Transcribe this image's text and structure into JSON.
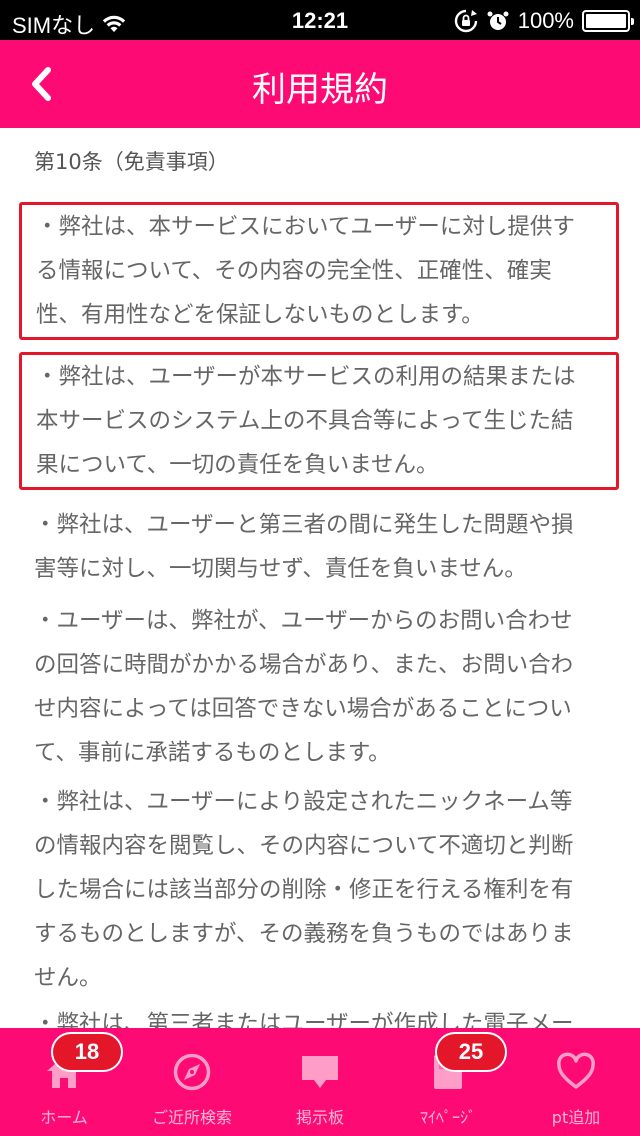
{
  "status_bar": {
    "carrier": "SIMなし",
    "time": "12:21",
    "battery": "100%",
    "battery_level": 1.0
  },
  "header": {
    "title": "利用規約",
    "back_icon": "chevron-left-icon"
  },
  "content": {
    "section_title": "第10条（免責事項）",
    "paragraphs": [
      {
        "lines": [
          "・弊社は、本サービスにおいてユーザーに対し提供す",
          "る情報について、その内容の完全性、正確性、確実",
          "性、有用性などを保証しないものとします。"
        ],
        "highlighted": true
      },
      {
        "lines": [
          "・弊社は、ユーザーが本サービスの利用の結果または",
          "本サービスのシステム上の不具合等によって生じた結",
          "果について、一切の責任を負いません。"
        ],
        "highlighted": true
      },
      {
        "lines": [
          "・弊社は、ユーザーと第三者の間に発生した問題や損",
          "害等に対し、一切関与せず、責任を負いません。"
        ],
        "highlighted": false
      },
      {
        "lines": [
          "・ユーザーは、弊社が、ユーザーからのお問い合わせ",
          "の回答に時間がかかる場合があり、また、お問い合わ",
          "せ内容によっては回答できない場合があることについ",
          "て、事前に承諾するものとします。"
        ],
        "highlighted": false
      },
      {
        "lines": [
          "・弊社は、ユーザーにより設定されたニックネーム等",
          "の情報内容を閲覧し、その内容について不適切と判断",
          "した場合には該当部分の削除・修正を行える権利を有",
          "するものとしますが、その義務を負うものではありま",
          "せん。"
        ],
        "highlighted": false
      },
      {
        "lines": [
          "・弊社は、第三者またはユーザーが作成した電子メー"
        ],
        "highlighted": false
      }
    ]
  },
  "tab_bar": {
    "tabs": [
      {
        "label": "ホーム",
        "icon": "home-icon",
        "badge": "18"
      },
      {
        "label": "ご近所検索",
        "icon": "compass-icon",
        "badge": ""
      },
      {
        "label": "掲示板",
        "icon": "speech-bubble-icon",
        "badge": ""
      },
      {
        "label": "ﾏｲﾍﾟｰｼﾞ",
        "icon": "profile-page-icon",
        "badge": "25"
      },
      {
        "label": "pt追加",
        "icon": "heart-icon",
        "badge": ""
      }
    ]
  },
  "colors": {
    "brand_pink": "#fd0a75",
    "highlight_red": "#e4172a",
    "badge_red": "#e4172a"
  }
}
